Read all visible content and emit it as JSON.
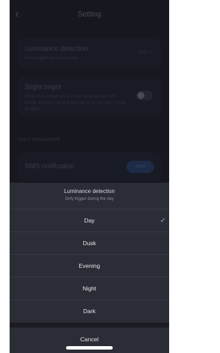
{
  "header": {
    "back_icon": "chevron-left-icon",
    "title": "Setting"
  },
  "luminance_card": {
    "title": "Luminance detection",
    "subtitle": "Only trigger during the day",
    "value": "Day >"
  },
  "slight_card": {
    "title": "Slight bright",
    "description": "When it is turned on, it is the same as full light mode, and the camera will not be in full color mode at night",
    "toggle_on": false
  },
  "alarm_section": {
    "label": "Alarm management"
  },
  "sms_card": {
    "title": "SMS notification",
    "button": "Sent"
  },
  "sheet": {
    "title": "Luminance detection",
    "subtitle": "Only trigger during the day",
    "options": [
      "Day",
      "Dusk",
      "Evening",
      "Night",
      "Dark"
    ],
    "selected": "Day",
    "check_icon": "checkmark-icon",
    "cancel": "Cancel"
  },
  "colors": {
    "background": "#20222c",
    "sheet": "#2a2c36",
    "accent": "#2f4577"
  }
}
